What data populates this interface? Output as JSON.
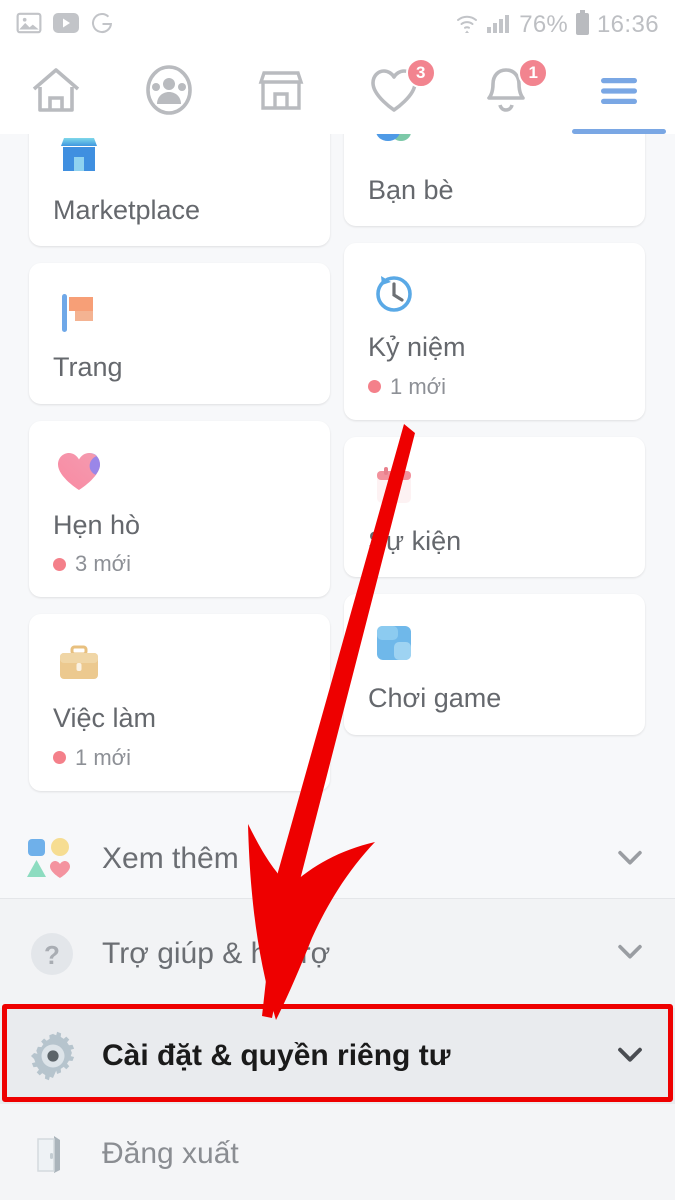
{
  "statusbar": {
    "left_icons": [
      "image-icon",
      "youtube-icon",
      "google-icon"
    ],
    "wifi_icon": "wifi-icon",
    "signal_icon": "cellular-signal-icon",
    "battery_percent": "76%",
    "battery_icon": "battery-icon",
    "time": "16:36"
  },
  "tabbar": {
    "tabs": [
      {
        "name": "home-tab",
        "icon": "home-icon",
        "badge": ""
      },
      {
        "name": "friends-tab",
        "icon": "friends-icon",
        "badge": ""
      },
      {
        "name": "marketplace-tab",
        "icon": "shop-icon",
        "badge": ""
      },
      {
        "name": "watch-tab",
        "icon": "heart-icon",
        "badge": "3"
      },
      {
        "name": "notifications-tab",
        "icon": "bell-icon",
        "badge": "1"
      },
      {
        "name": "menu-tab",
        "icon": "hamburger-icon",
        "badge": ""
      }
    ],
    "active_tab": "menu-tab"
  },
  "shortcuts": {
    "left_column": [
      {
        "label": "Marketplace",
        "icon": "shop-color-icon",
        "sub": ""
      },
      {
        "label": "Trang",
        "icon": "flag-icon",
        "sub": ""
      },
      {
        "label": "Hẹn hò",
        "icon": "heart-color-icon",
        "sub": "3 mới"
      },
      {
        "label": "Việc làm",
        "icon": "briefcase-icon",
        "sub": "1 mới"
      }
    ],
    "right_column": [
      {
        "label": "Bạn bè",
        "icon": "friends-color-icon",
        "sub": ""
      },
      {
        "label": "Kỷ niệm",
        "icon": "clock-rewind-icon",
        "sub": "1 mới"
      },
      {
        "label": "Sự kiện",
        "icon": "calendar-icon",
        "sub": ""
      },
      {
        "label": "Chơi game",
        "icon": "gamepad-icon",
        "sub": ""
      }
    ]
  },
  "menu_rows": [
    {
      "label": "Xem thêm",
      "icon": "shapes-icon",
      "chevron": "chevron-down-icon"
    },
    {
      "label": "Trợ giúp & hỗ trợ",
      "icon": "question-icon",
      "chevron": "chevron-down-icon"
    },
    {
      "label": "Cài đặt & quyền riêng tư",
      "icon": "gear-icon",
      "chevron": "chevron-down-icon"
    },
    {
      "label": "Đăng xuất",
      "icon": "logout-door-icon",
      "chevron": ""
    }
  ],
  "annotation": {
    "arrow_color": "#ee0000",
    "highlight_color": "#ee0000",
    "highlight_target": "Cài đặt & quyền riêng tư"
  },
  "colors": {
    "accent_blue": "#7aa7e4",
    "badge_pink": "#f2848f",
    "page_bg": "#f7f8fa",
    "card_bg": "#ffffff",
    "highlight_row_bg": "#e9ebee"
  }
}
